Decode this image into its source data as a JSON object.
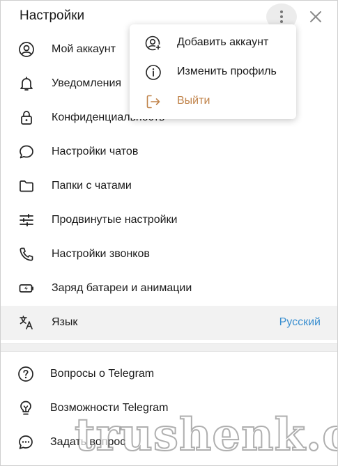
{
  "header": {
    "title": "Настройки"
  },
  "menu": {
    "items": [
      {
        "label": "Добавить аккаунт",
        "icon": "add-account-icon"
      },
      {
        "label": "Изменить профиль",
        "icon": "info-icon"
      },
      {
        "label": "Выйти",
        "icon": "logout-icon"
      }
    ]
  },
  "settings": {
    "items": [
      {
        "label": "Мой аккаунт",
        "icon": "account-icon"
      },
      {
        "label": "Уведомления",
        "icon": "bell-icon"
      },
      {
        "label": "Конфиденциальность",
        "icon": "lock-icon"
      },
      {
        "label": "Настройки чатов",
        "icon": "chat-bubble-icon"
      },
      {
        "label": "Папки с чатами",
        "icon": "folder-icon"
      },
      {
        "label": "Продвинутые настройки",
        "icon": "sliders-icon"
      },
      {
        "label": "Настройки звонков",
        "icon": "phone-icon"
      },
      {
        "label": "Заряд батареи и анимации",
        "icon": "battery-icon"
      },
      {
        "label": "Язык",
        "icon": "translate-icon",
        "value": "Русский"
      }
    ],
    "help": [
      {
        "label": "Вопросы о Telegram",
        "icon": "question-icon"
      },
      {
        "label": "Возможности Telegram",
        "icon": "lightbulb-icon"
      },
      {
        "label": "Задать вопрос",
        "icon": "chat-dots-icon"
      }
    ]
  },
  "watermark": "trushenk.com",
  "colors": {
    "accent": "#3a8fd0",
    "logout": "#c0834a"
  }
}
